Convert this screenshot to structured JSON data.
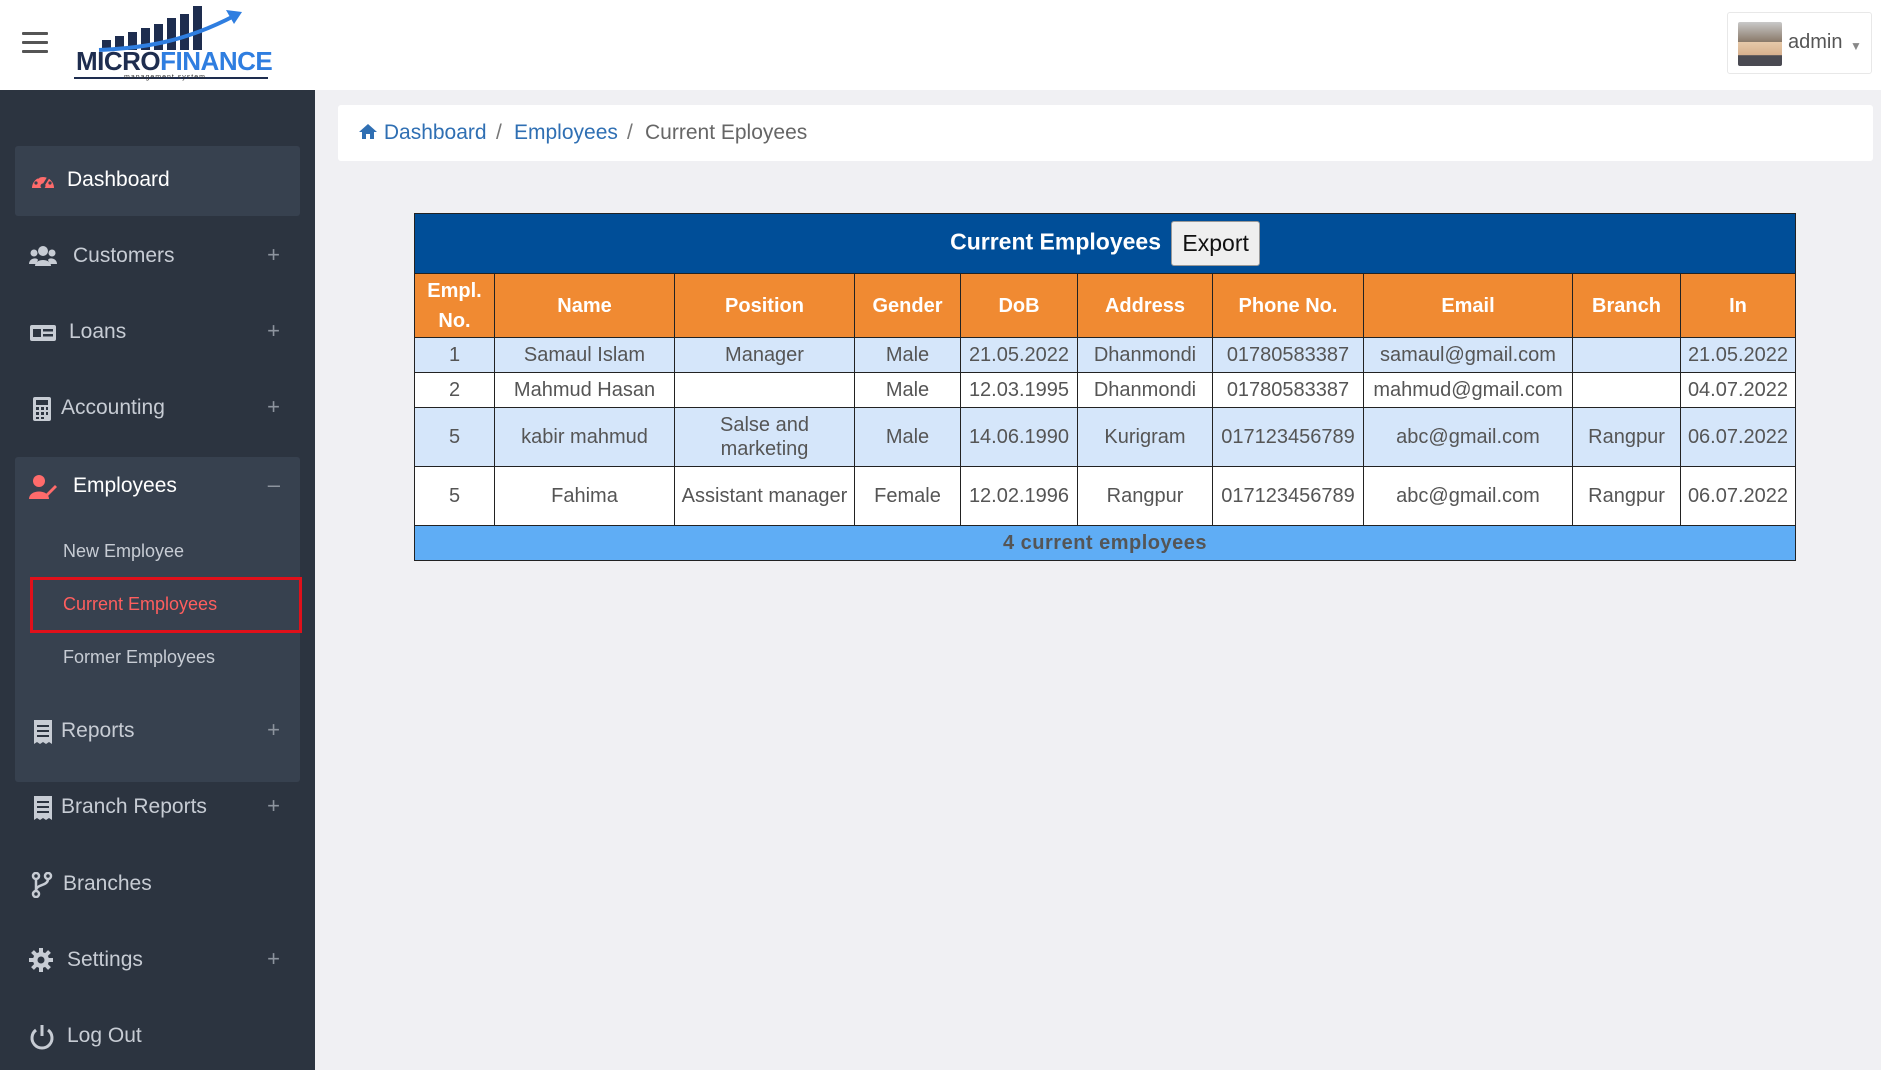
{
  "header": {
    "logo_main": "MICRO",
    "logo_accent": "FINANCE",
    "logo_sub": "management system",
    "user_name": "admin"
  },
  "sidebar": {
    "items": [
      {
        "label": "Dashboard",
        "icon": "dashboard-icon"
      },
      {
        "label": "Customers",
        "icon": "users-icon"
      },
      {
        "label": "Loans",
        "icon": "money-icon"
      },
      {
        "label": "Accounting",
        "icon": "calculator-icon"
      },
      {
        "label": "Employees",
        "icon": "user-edit-icon"
      },
      {
        "label": "Reports",
        "icon": "receipt-icon"
      },
      {
        "label": "Branch Reports",
        "icon": "receipt-icon"
      },
      {
        "label": "Branches",
        "icon": "branch-icon"
      },
      {
        "label": "Settings",
        "icon": "gear-icon"
      },
      {
        "label": "Log Out",
        "icon": "power-icon"
      }
    ],
    "employees_sub": [
      "New Employee",
      "Current Employees",
      "Former Employees"
    ]
  },
  "breadcrumb": {
    "home": "Dashboard",
    "section": "Employees",
    "current": "Current Eployees"
  },
  "table": {
    "title": "Current Employees",
    "export_label": "Export",
    "columns": [
      "Empl. No.",
      "Name",
      "Position",
      "Gender",
      "DoB",
      "Address",
      "Phone No.",
      "Email",
      "Branch",
      "In"
    ],
    "rows": [
      [
        "1",
        "Samaul Islam",
        "Manager",
        "Male",
        "21.05.2022",
        "Dhanmondi",
        "01780583387",
        "samaul@gmail.com",
        "",
        "21.05.2022"
      ],
      [
        "2",
        "Mahmud Hasan",
        "",
        "Male",
        "12.03.1995",
        "Dhanmondi",
        "01780583387",
        "mahmud@gmail.com",
        "",
        "04.07.2022"
      ],
      [
        "5",
        "kabir mahmud",
        "Salse and marketing",
        "Male",
        "14.06.1990",
        "Kurigram",
        "017123456789",
        "abc@gmail.com",
        "Rangpur",
        "06.07.2022"
      ],
      [
        "5",
        "Fahima",
        "Assistant manager",
        "Female",
        "12.02.1996",
        "Rangpur",
        "017123456789",
        "abc@gmail.com",
        "Rangpur",
        "06.07.2022"
      ]
    ],
    "footer": "4 current employees"
  },
  "colors": {
    "sidebar_bg": "#2c3440",
    "table_title_bg": "#004e98",
    "table_header_bg": "#f08a32",
    "table_footer_bg": "#5fadf5",
    "row_alt_bg": "#d5e6fa",
    "active_submenu": "#ff5e5e",
    "link": "#2f6fb3"
  }
}
